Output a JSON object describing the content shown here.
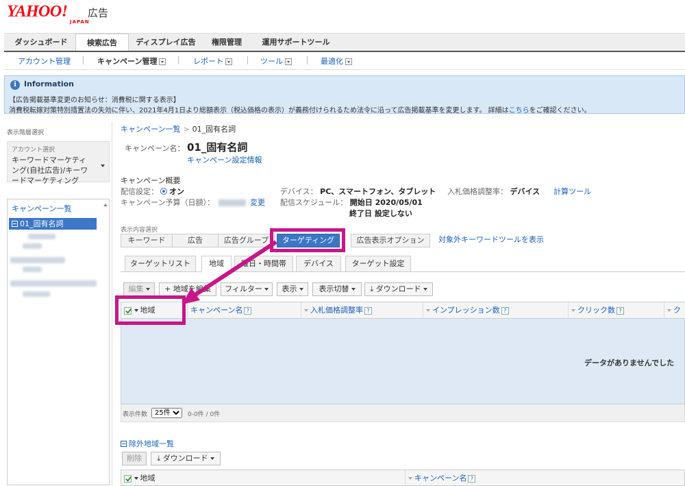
{
  "brand": {
    "logo_main": "YAHOO!",
    "logo_sub": "JAPAN",
    "product": "広告"
  },
  "top_tabs": [
    "ダッシュボード",
    "検索広告",
    "ディスプレイ広告",
    "権限管理",
    "運用サポートツール"
  ],
  "sub_nav": {
    "account": "アカウント管理",
    "campaign": "キャンペーン管理",
    "report": "レポート",
    "tool": "ツール",
    "optimize": "最適化"
  },
  "info": {
    "title": "Information",
    "line1": "【広告掲載基準変更のお知らせ：消費税に関する表示】",
    "line2_pre": "消費税転嫁対策特別措置法の失効に伴い、2021年4月1日より総額表示（税込価格の表示）が義務付けられるため法令に沿って広告掲載基準を変更します。 詳細は",
    "line2_link": "こちら",
    "line2_post": "をご確認ください。"
  },
  "sidebar": {
    "hierarchy_label": "表示階層選択",
    "account_label": "アカウント選択",
    "account_value": "キーワードマーケティング(自社広告)/キーワードマーケティング",
    "campaign_list": "キャンペーン一覧",
    "selected_campaign": "01_固有名詞"
  },
  "breadcrumb": {
    "root": "キャンペーン一覧",
    "sep": ">",
    "current": "01_固有名詞"
  },
  "campaign": {
    "name_label": "キャンペーン名：",
    "name": "01_固有名詞",
    "settings_link": "キャンペーン設定情報",
    "summary_title": "キャンペーン概要",
    "delivery_label": "配信設定：",
    "delivery_value": "オン",
    "budget_label": "キャンペーン予算（日額）：",
    "budget_change": "変更",
    "device_label": "デバイス：",
    "device_value": "PC、スマートフォン、タブレット",
    "bid_label": "入札価格調整率：",
    "bid_value": "デバイス",
    "calc_tool": "計算ツール",
    "schedule_label": "配信スケジュール：",
    "start": "開始日 2020/05/01",
    "end": "終了日 設定しない"
  },
  "view": {
    "label": "表示内容選択",
    "tabs": [
      "キーワード",
      "広告",
      "広告グループ",
      "ターゲティング",
      "広告表示オプション"
    ],
    "kw_tool_link": "対象外キーワードツールを表示"
  },
  "sub_tabs": [
    "ターゲットリスト",
    "地域",
    "曜日・時間帯",
    "デバイス",
    "ターゲット設定"
  ],
  "toolbar": {
    "edit": "編集",
    "add": "地域を編集",
    "filter": "フィルター",
    "display": "表示",
    "switch": "表示切替",
    "download": "ダウンロード"
  },
  "grid": {
    "columns": [
      "地域",
      "キャンペーン名",
      "入札価格調整率",
      "インプレッション数",
      "クリック数",
      "ク"
    ],
    "empty": "データがありませんでした",
    "help": "?"
  },
  "pager": {
    "label": "表示件数",
    "per_page": "25件",
    "count": "0-0件 / 0件"
  },
  "exclusion": {
    "title": "除外地域一覧",
    "delete": "削除",
    "download": "ダウンロード",
    "columns": [
      "地域",
      "キャンペーン名"
    ]
  },
  "colors": {
    "highlight": "#c8168a",
    "accent": "#3c77c7"
  }
}
